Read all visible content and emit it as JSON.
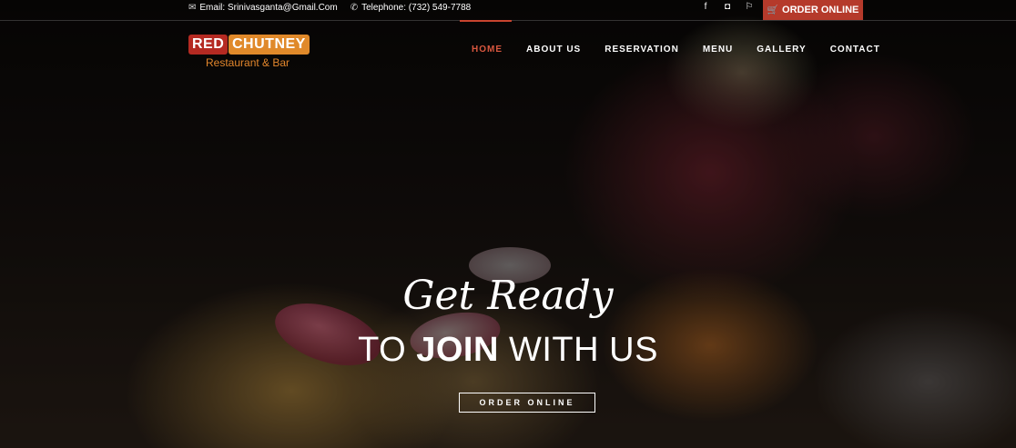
{
  "topbar": {
    "email": "Email: Srinivasganta@Gmail.Com",
    "telephone": "Telephone: (732) 549-7788",
    "order_online": "ORDER ONLINE"
  },
  "logo": {
    "word1": "RED",
    "word2": "CHUTNEY",
    "tagline": "Restaurant & Bar"
  },
  "nav": {
    "items": [
      "HOME",
      "ABOUT US",
      "RESERVATION",
      "MENU",
      "GALLERY",
      "CONTACT"
    ],
    "active": "HOME"
  },
  "hero": {
    "line1": "Get Ready",
    "line2_pre": "TO",
    "line2_bold": "JOIN",
    "line2_post": "WITH US",
    "button": "ORDER ONLINE"
  },
  "icons": {
    "email": "envelope-icon",
    "phone": "phone-icon",
    "social": [
      "facebook-icon",
      "instagram-icon",
      "foursquare-icon"
    ],
    "cart": "cart-icon"
  },
  "colors": {
    "accent_red": "#b53a2b",
    "nav_active": "#d9573f",
    "logo_orange": "#e0892a"
  }
}
